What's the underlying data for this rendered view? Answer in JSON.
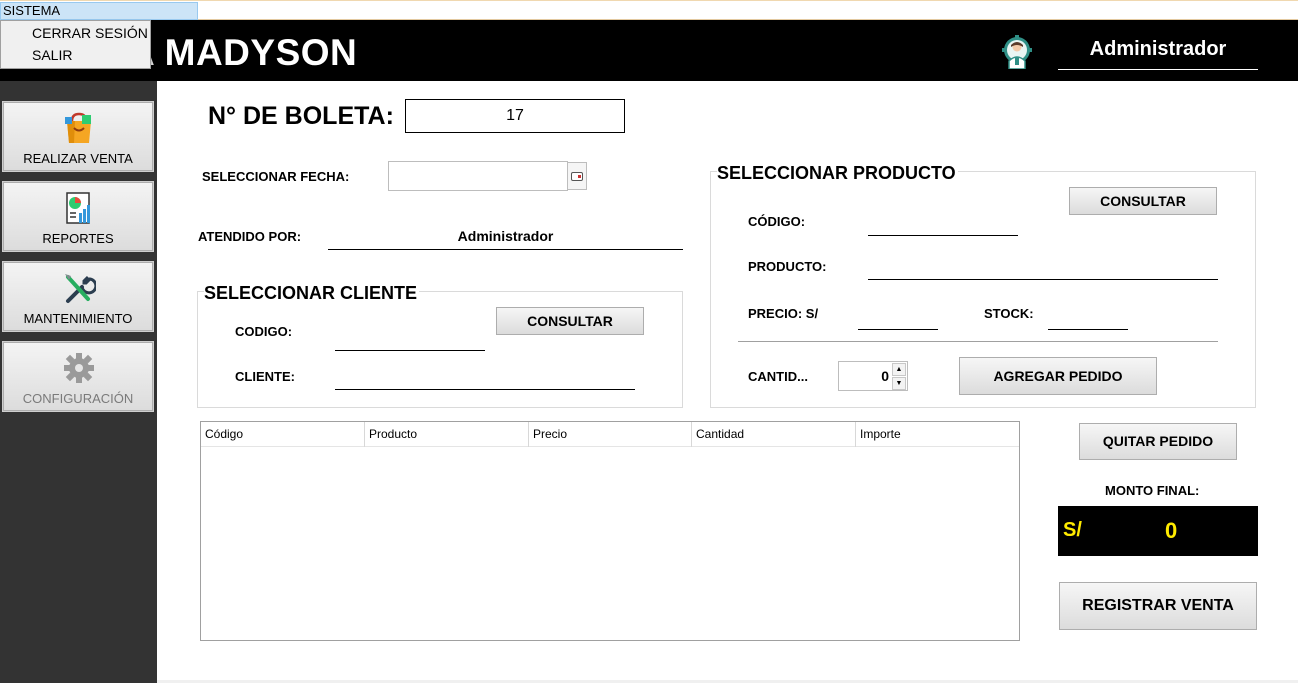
{
  "menu": {
    "sistema": "SISTEMA",
    "items": [
      "CERRAR SESIÓN",
      "SALIR"
    ]
  },
  "header": {
    "title": "A MADYSON",
    "user": "Administrador",
    "user_icon": "admin-gear-icon"
  },
  "sidebar": {
    "items": [
      {
        "label": "REALIZAR VENTA",
        "icon": "shopping-bag-icon"
      },
      {
        "label": "REPORTES",
        "icon": "report-chart-icon"
      },
      {
        "label": "MANTENIMIENTO",
        "icon": "tools-icon"
      },
      {
        "label": "CONFIGURACIÓN",
        "icon": "gear-icon",
        "disabled": true
      }
    ]
  },
  "boleta": {
    "label": "N° DE BOLETA:",
    "value": "17"
  },
  "fecha": {
    "label": "SELECCIONAR FECHA:",
    "value": ""
  },
  "atendido": {
    "label": "ATENDIDO POR:",
    "value": "Administrador"
  },
  "cliente": {
    "title": "SELECCIONAR CLIENTE",
    "consultar": "CONSULTAR",
    "codigo_label": "CODIGO:",
    "codigo_value": "",
    "cliente_label": "CLIENTE:",
    "cliente_value": ""
  },
  "producto": {
    "title": "SELECCIONAR PRODUCTO",
    "consultar": "CONSULTAR",
    "codigo_label": "CÓDIGO:",
    "codigo_value": "",
    "producto_label": "PRODUCTO:",
    "producto_value": "",
    "precio_label": "PRECIO: S/",
    "precio_value": "",
    "stock_label": "STOCK:",
    "stock_value": "",
    "cantidad_label": "CANTID...",
    "cantidad_value": "0",
    "agregar": "AGREGAR PEDIDO"
  },
  "table": {
    "columns": [
      "Código",
      "Producto",
      "Precio",
      "Cantidad",
      "Importe"
    ],
    "rows": []
  },
  "actions": {
    "quitar": "QUITAR PEDIDO",
    "monto_label": "MONTO FINAL:",
    "currency": "S/",
    "monto_value": "0",
    "registrar": "REGISTRAR VENTA"
  },
  "colors": {
    "header_bg": "#000000",
    "sidebar_bg": "#333333",
    "monto_text": "#ffeb00"
  }
}
